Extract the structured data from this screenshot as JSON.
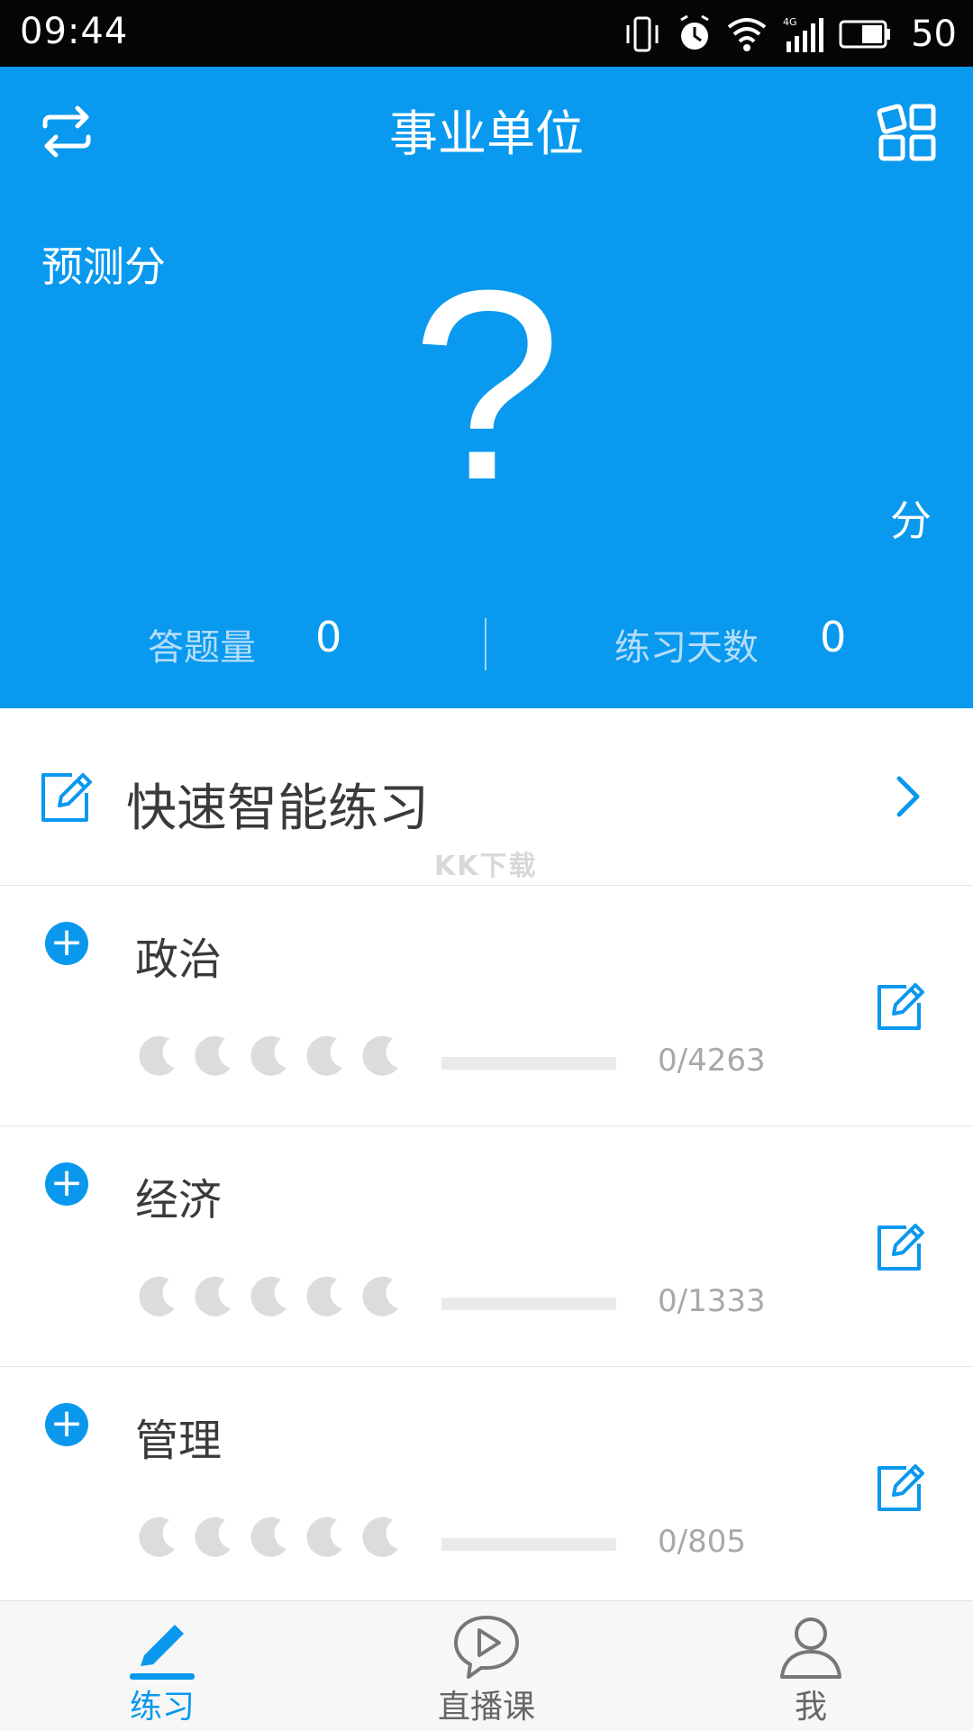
{
  "status_bar": {
    "time": "09:44",
    "battery": "50"
  },
  "header": {
    "title": "事业单位"
  },
  "hero": {
    "predicted_label": "预测分",
    "predicted_value": "?",
    "unit": "分",
    "stats": [
      {
        "label": "答题量",
        "value": "0"
      },
      {
        "label": "练习天数",
        "value": "0"
      }
    ]
  },
  "quick_practice": {
    "label": "快速智能练习"
  },
  "watermark": "KK下载",
  "subjects": [
    {
      "name": "政治",
      "count": "0/4263",
      "progress": 0
    },
    {
      "name": "经济",
      "count": "0/1333",
      "progress": 0
    },
    {
      "name": "管理",
      "count": "0/805",
      "progress": 0
    }
  ],
  "tabs": [
    {
      "label": "练习",
      "icon": "pencil-icon",
      "active": true
    },
    {
      "label": "直播课",
      "icon": "video-chat-icon",
      "active": false
    },
    {
      "label": "我",
      "icon": "person-icon",
      "active": false
    }
  ],
  "colors": {
    "primary": "#0999ee",
    "tab_active": "#0a98ee",
    "tab_inactive": "#666666"
  }
}
